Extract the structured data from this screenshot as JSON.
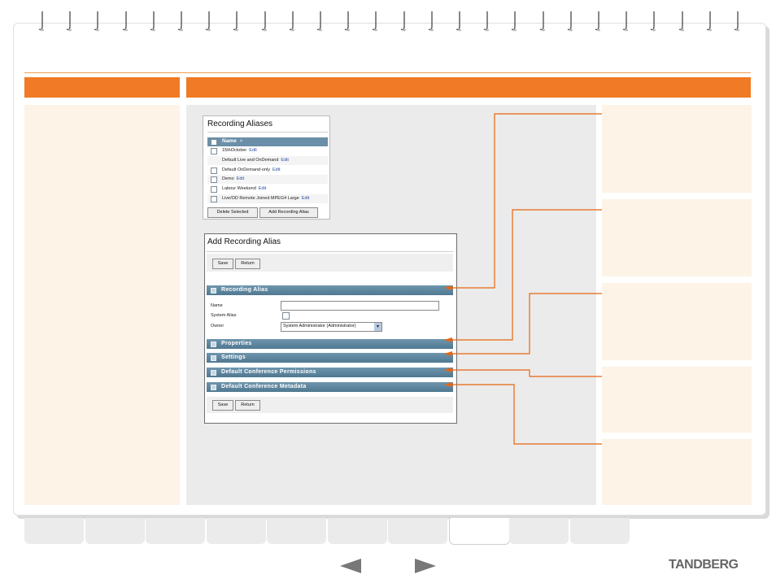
{
  "brand": {
    "logo": "TANDBERG",
    "accent": "#f07a25"
  },
  "recording_aliases": {
    "title": "Recording Aliases",
    "column_header": "Name",
    "rows": [
      {
        "name": "15thOctober",
        "edit": "Edit",
        "checkbox": true
      },
      {
        "name": "Default Live and OnDemand",
        "edit": "Edit",
        "checkbox": false
      },
      {
        "name": "Default OnDemand-only",
        "edit": "Edit",
        "checkbox": true
      },
      {
        "name": "Demo",
        "edit": "Edit",
        "checkbox": true
      },
      {
        "name": "Labour Weekend",
        "edit": "Edit",
        "checkbox": true
      },
      {
        "name": "Live/OD Remote Joined MPEG4 Large",
        "edit": "Edit",
        "checkbox": true
      }
    ],
    "delete_button": "Delete Selected",
    "add_button": "Add Recording Alias"
  },
  "add_recording_alias": {
    "title": "Add Recording Alias",
    "save_label": "Save",
    "return_label": "Return",
    "sections": [
      "Recording Alias",
      "Properties",
      "Settings",
      "Default Conference Permissions",
      "Default Conference Metadata"
    ],
    "fields": {
      "name_label": "Name",
      "name_value": "",
      "system_alias_label": "System Alias",
      "owner_label": "Owner",
      "owner_value": "System Administrator (Administrator)"
    }
  }
}
